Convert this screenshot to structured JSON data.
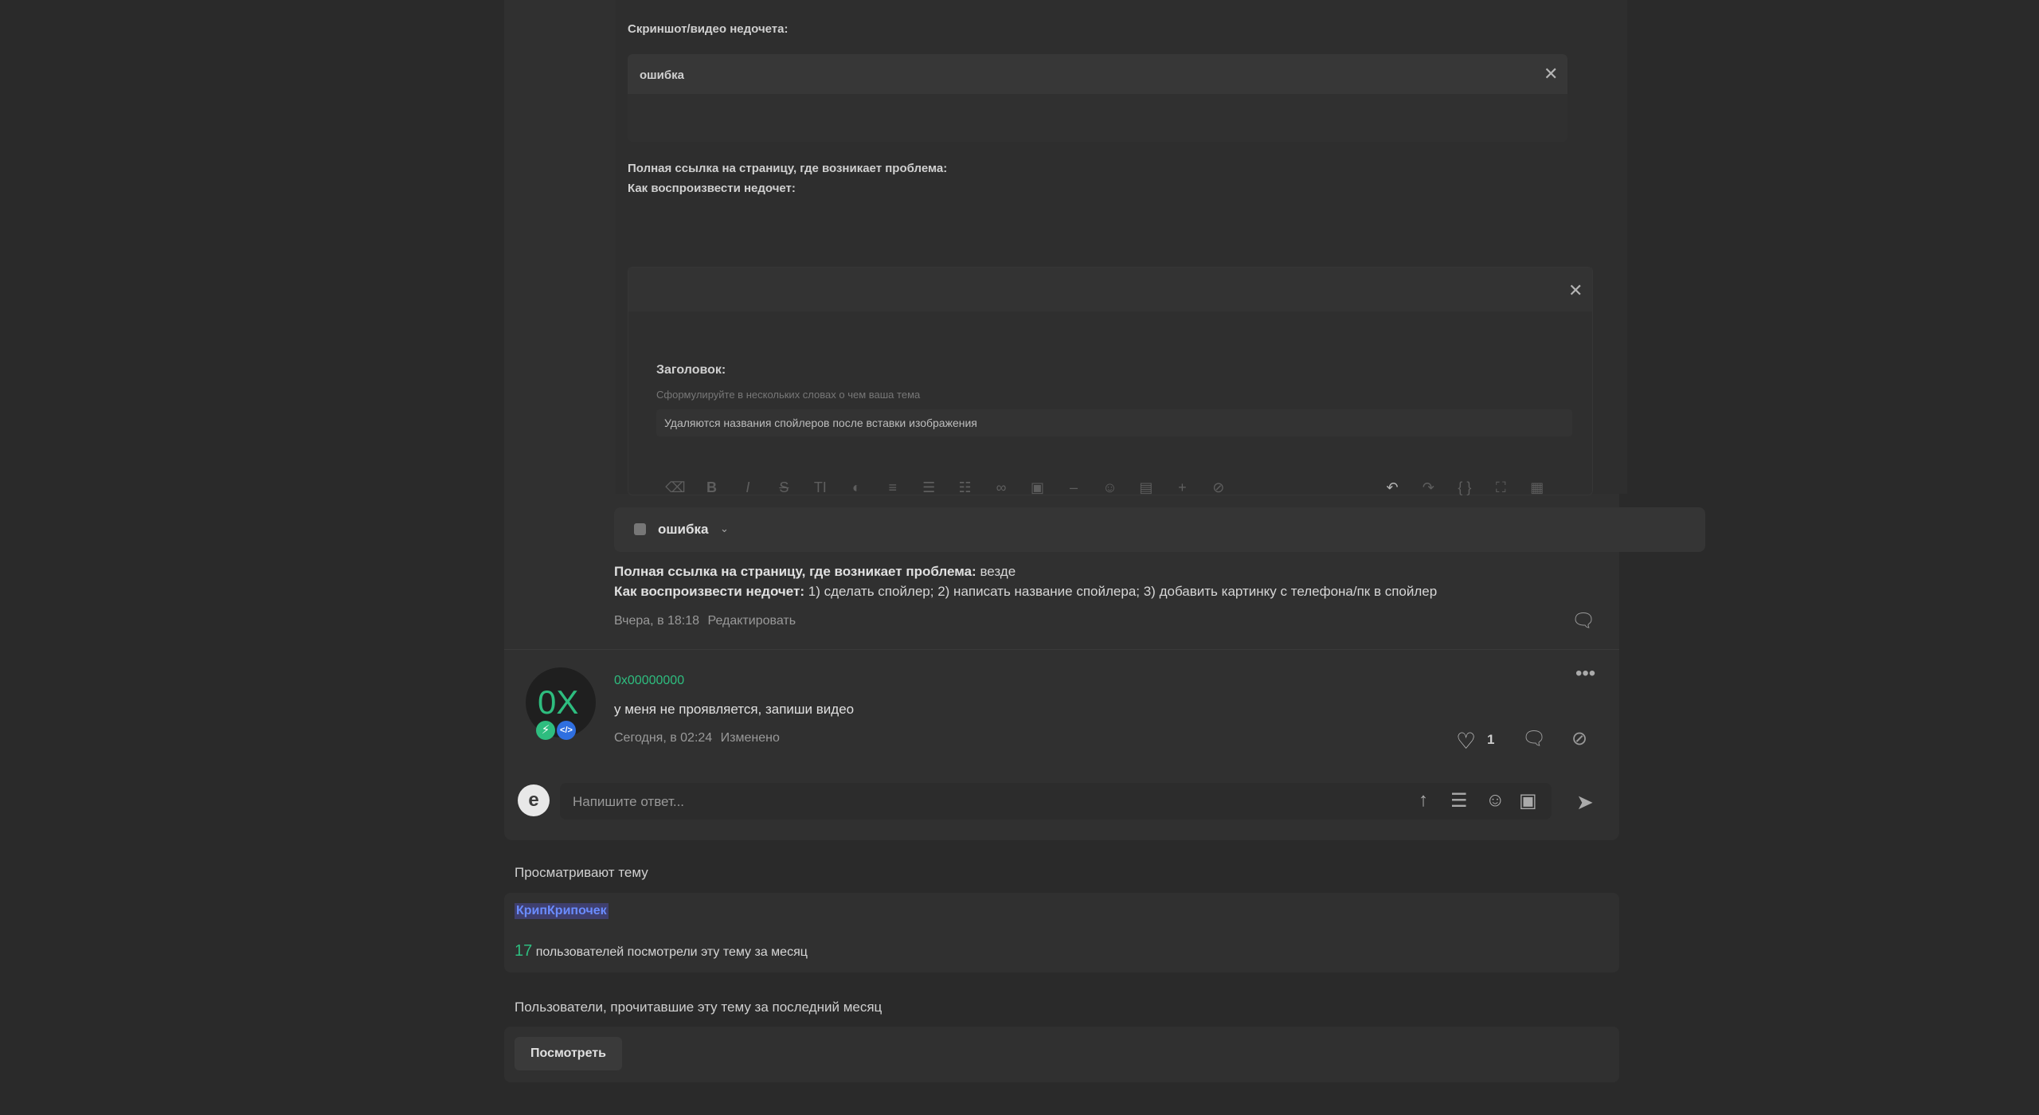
{
  "embedded_form": {
    "screenshot_label": "Скриншот/видео недочета:",
    "spoiler_title": "ошибка",
    "link_label": "Полная ссылка на страницу, где возникает проблема:",
    "repro_label": "Как воспроизвести недочет:",
    "title_label": "Заголовок:",
    "title_hint": "Сформулируйте в нескольких словах о чем ваша тема",
    "title_value": "Удаляются названия спойлеров после вставки изображения"
  },
  "post1": {
    "spoiler_label": "ошибка",
    "link_label": "Полная ссылка на страницу, где возникает проблема:",
    "link_value": "везде",
    "repro_label": "Как воспроизвести недочет:",
    "repro_value": "1) сделать спойлер; 2) написать название спойлера; 3) добавить картинку с телефона/пк в спойлер",
    "date": "Вчера, в 18:18",
    "edit_link": "Редактировать"
  },
  "post2": {
    "avatar_text": "0X",
    "author": "0x00000000",
    "text": "у меня не проявляется, запиши видео",
    "date": "Сегодня, в 02:24",
    "edited": "Изменено",
    "likes": "1"
  },
  "reply": {
    "placeholder": "Напишите ответ..."
  },
  "viewers": {
    "heading": "Просматривают тему",
    "user": "КрипКрипочек",
    "count": "17",
    "count_text": "пользователей посмотрели эту тему за месяц"
  },
  "readers": {
    "heading": "Пользователи, прочитавшие эту тему за последний месяц",
    "button": "Посмотреть"
  },
  "colors": {
    "accent_green": "#2ebd7f",
    "background": "#2a2a2a",
    "panel": "#303030"
  }
}
